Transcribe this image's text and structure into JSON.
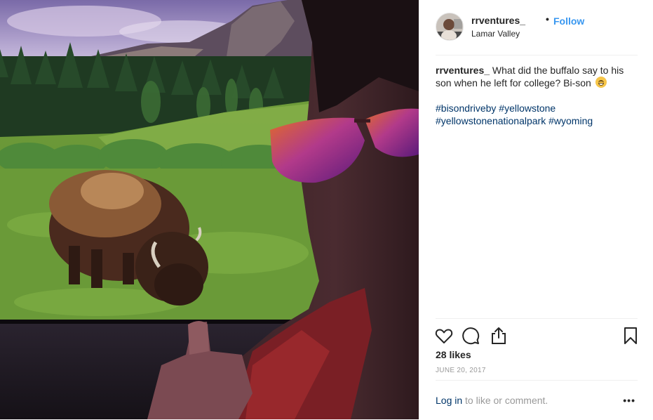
{
  "post": {
    "username": "rrventures_",
    "dot": "•",
    "follow_label": "Follow",
    "location": "Lamar Valley",
    "caption_user": "rrventures_",
    "caption_text": " What did the buffalo say to his son when he left for college? Bi-son ",
    "tags": [
      "#bisondriveby",
      "#yellowstone",
      "#yellowstonenationalpark",
      "#wyoming"
    ],
    "likes": "28 likes",
    "date": "JUNE 20, 2017",
    "login_link": "Log in",
    "login_suffix": " to like or comment.",
    "more_label": "•••"
  },
  "icons": {
    "like": "heart-outline-icon",
    "comment": "comment-bubble-icon",
    "share": "share-upload-icon",
    "save": "bookmark-icon",
    "caption_emoji": "grinning-sweat-emoji"
  },
  "colors": {
    "accent": "#3897f0",
    "link": "#003569",
    "muted": "#999999",
    "text": "#262626"
  }
}
